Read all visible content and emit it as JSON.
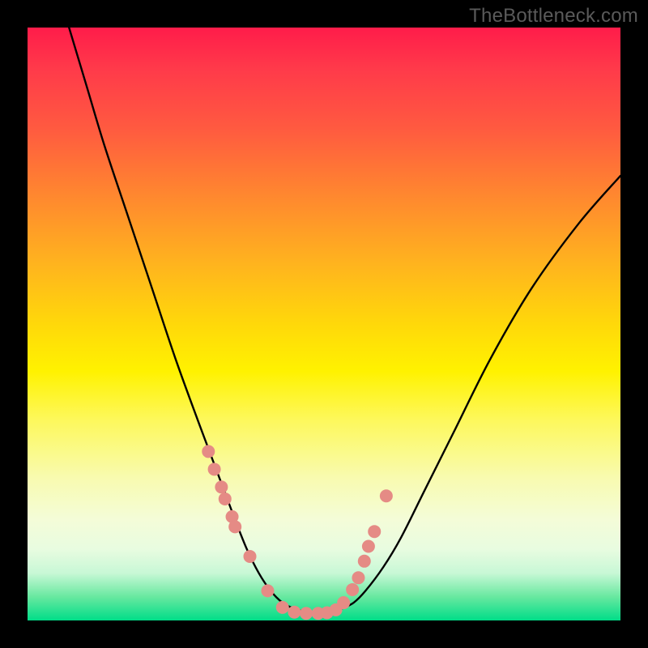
{
  "watermark": "TheBottleneck.com",
  "chart_data": {
    "type": "line",
    "title": "",
    "xlabel": "",
    "ylabel": "",
    "xlim": [
      0,
      100
    ],
    "ylim": [
      0,
      100
    ],
    "series": [
      {
        "name": "curve",
        "x": [
          7,
          10,
          13,
          17,
          21,
          25,
          29,
          32,
          35,
          37,
          39,
          41,
          43,
          45,
          48,
          51,
          53,
          55,
          57,
          60,
          63,
          67,
          72,
          78,
          85,
          93,
          100
        ],
        "values": [
          100,
          90,
          80,
          68,
          56,
          44,
          33,
          25,
          17,
          12,
          8,
          5,
          3,
          2,
          1.2,
          1.2,
          2,
          3,
          5,
          9,
          14,
          22,
          32,
          44,
          56,
          67,
          75
        ]
      }
    ],
    "scatter_points": {
      "name": "dots",
      "color": "#e58b85",
      "radius_px": 8,
      "x": [
        30.5,
        31.5,
        32.7,
        33.3,
        34.5,
        35.0,
        37.5,
        40.5,
        43.0,
        45.0,
        47.0,
        49.0,
        50.5,
        52.0,
        53.3,
        54.8,
        55.8,
        56.8,
        57.5,
        58.5,
        60.5
      ],
      "values": [
        28.5,
        25.5,
        22.5,
        20.5,
        17.5,
        15.8,
        10.8,
        5.0,
        2.2,
        1.4,
        1.2,
        1.2,
        1.3,
        1.8,
        3.0,
        5.2,
        7.2,
        10.0,
        12.5,
        15.0,
        21.0
      ]
    }
  }
}
